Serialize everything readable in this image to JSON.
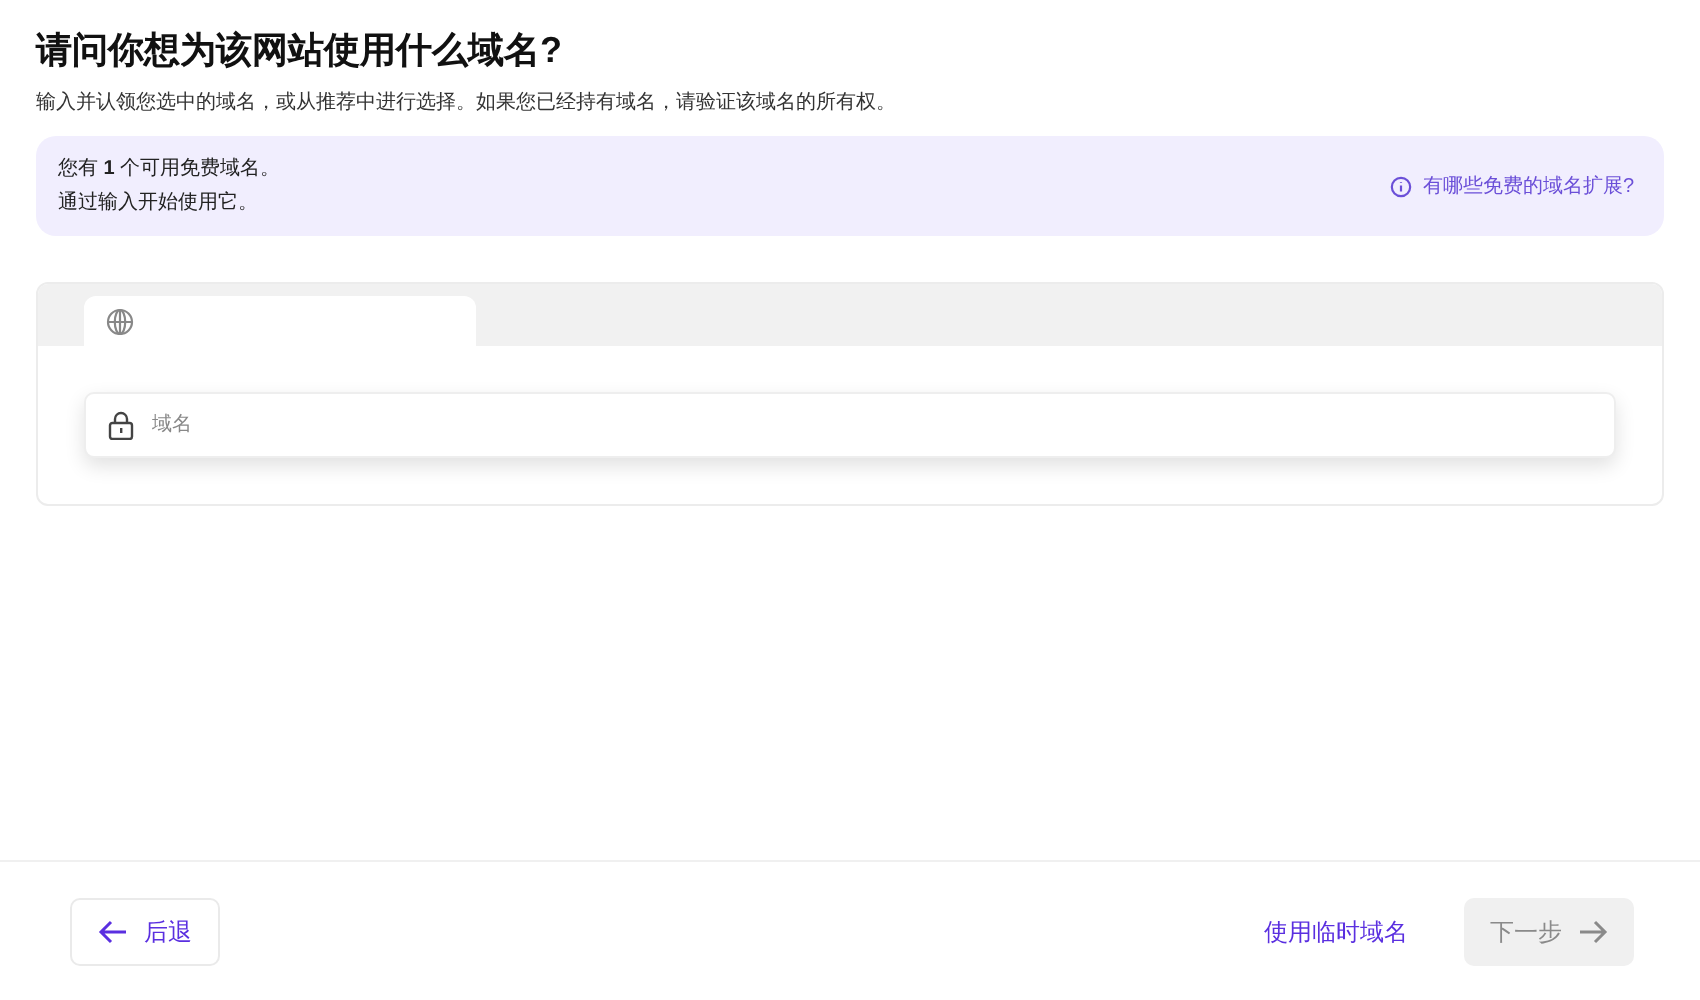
{
  "title": "请问你想为该网站使用什么域名?",
  "subtitle": "输入并认领您选中的域名，或从推荐中进行选择。如果您已经持有域名，请验证该域名的所有权。",
  "notice": {
    "lines": [
      "您有 **1** 个可用免费域名。",
      "通过输入开始使用它。"
    ],
    "link": "有哪些免费的域名扩展?"
  },
  "tabs": [
    {
      "kind": "globe",
      "selected": true
    }
  ],
  "domain_field": {
    "placeholder": "域名"
  },
  "footer": {
    "back": "后退",
    "temp_domain": "使用临时域名",
    "next": {
      "label": "下一步",
      "disabled": true
    }
  }
}
